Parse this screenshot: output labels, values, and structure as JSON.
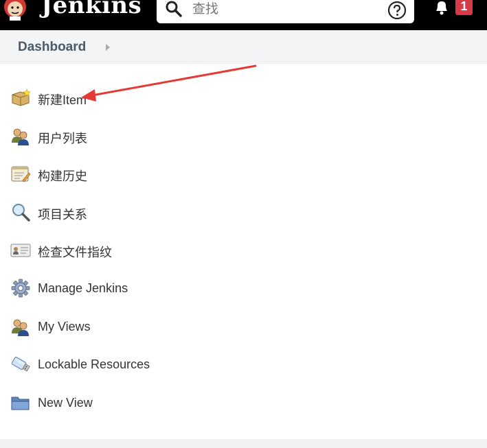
{
  "header": {
    "brand": "Jenkins",
    "search_placeholder": "查找",
    "notification_count": "1"
  },
  "breadcrumb": {
    "label": "Dashboard"
  },
  "menu": [
    {
      "label": "新建Item",
      "icon": "new-item-icon"
    },
    {
      "label": "用户列表",
      "icon": "users-icon"
    },
    {
      "label": "构建历史",
      "icon": "build-history-icon"
    },
    {
      "label": "项目关系",
      "icon": "magnifier-icon"
    },
    {
      "label": "检查文件指纹",
      "icon": "fingerprint-card-icon"
    },
    {
      "label": "Manage Jenkins",
      "icon": "gear-icon"
    },
    {
      "label": "My Views",
      "icon": "users-icon"
    },
    {
      "label": "Lockable Resources",
      "icon": "usb-drive-icon"
    },
    {
      "label": "New View",
      "icon": "folder-icon"
    }
  ],
  "colors": {
    "topbar": "#000000",
    "badge": "#d73a49",
    "annotation_arrow": "#e53935"
  }
}
